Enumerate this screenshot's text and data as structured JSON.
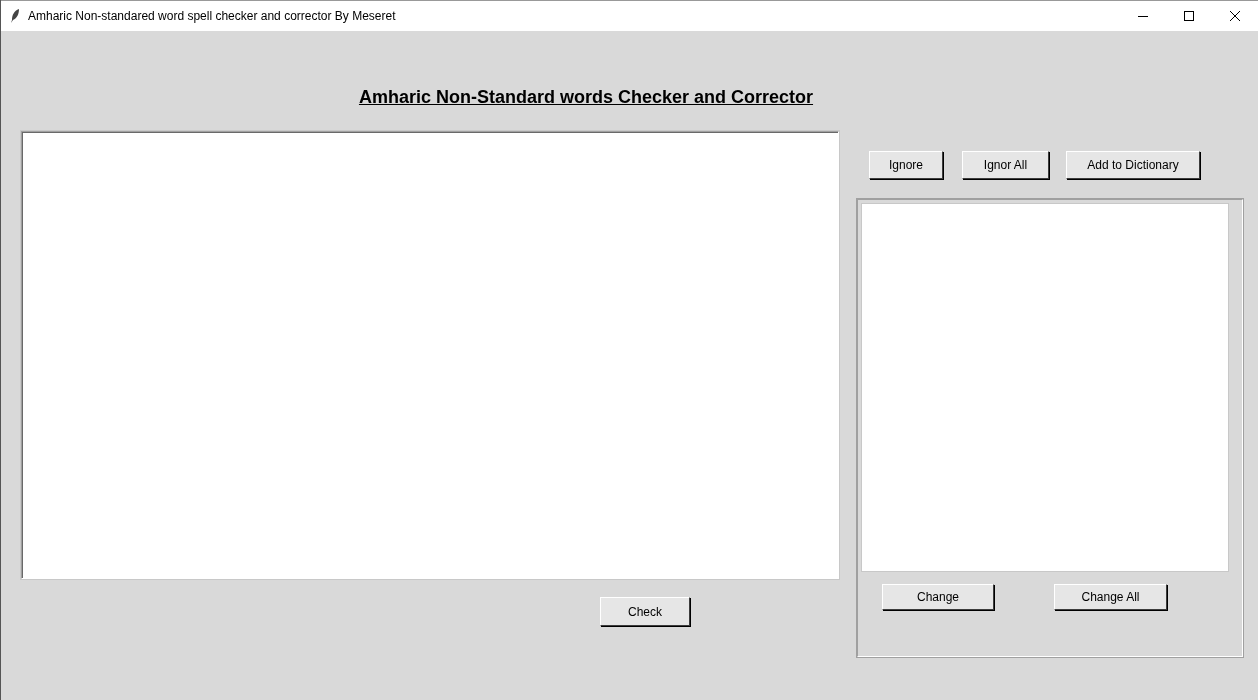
{
  "window": {
    "title": "Amharic Non-standared word spell checker and corrector By Meseret"
  },
  "heading": "Amharic Non-Standard words Checker and Corrector",
  "check_button": "Check",
  "toolbar_buttons": [
    "Ignore",
    "Ignor All",
    "Add to Dictionary"
  ],
  "suggestion_buttons": [
    "Change",
    "Change All"
  ]
}
